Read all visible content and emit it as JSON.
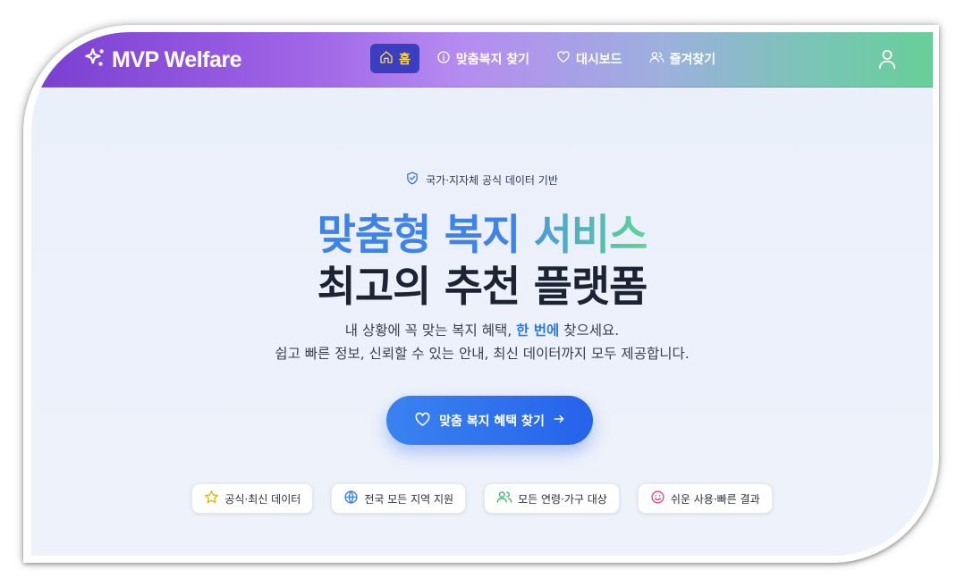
{
  "app": {
    "name": "MVP Welfare"
  },
  "nav": {
    "items": [
      {
        "label": "홈",
        "icon": "home-icon",
        "active": true
      },
      {
        "label": "맞춤복지 찾기",
        "icon": "info-icon",
        "active": false
      },
      {
        "label": "대시보드",
        "icon": "heart-icon",
        "active": false
      },
      {
        "label": "즐겨찾기",
        "icon": "users-icon",
        "active": false
      }
    ],
    "user_icon": "user-icon"
  },
  "hero": {
    "badge": "국가·지자체 공식 데이터 기반",
    "title_line1_part1": "맞춤형 복지",
    "title_line1_part2": "서비스",
    "title_line2": "최고의 추천 플랫폼",
    "subtitle1_before": "내 상황에 꼭 맞는 복지 혜택, ",
    "subtitle1_highlight": "한 번에",
    "subtitle1_after": " 찾으세요.",
    "subtitle2": "쉽고 빠른 정보, 신뢰할 수 있는 안내, 최신 데이터까지 모두 제공합니다.",
    "cta_label": "맞춤 복지 혜택 찾기"
  },
  "features": [
    {
      "label": "공식·최신 데이터",
      "icon": "star-icon"
    },
    {
      "label": "전국 모든 지역 지원",
      "icon": "globe-icon"
    },
    {
      "label": "모든 연령·가구 대상",
      "icon": "users-icon"
    },
    {
      "label": "쉬운 사용·빠른 결과",
      "icon": "smile-icon"
    }
  ],
  "colors": {
    "accent": "#2563eb",
    "active_nav_bg": "#3b3fbf",
    "active_nav_text": "#ffd84d",
    "title_blue": "#3f83e8",
    "title_green": "#5fd394"
  }
}
